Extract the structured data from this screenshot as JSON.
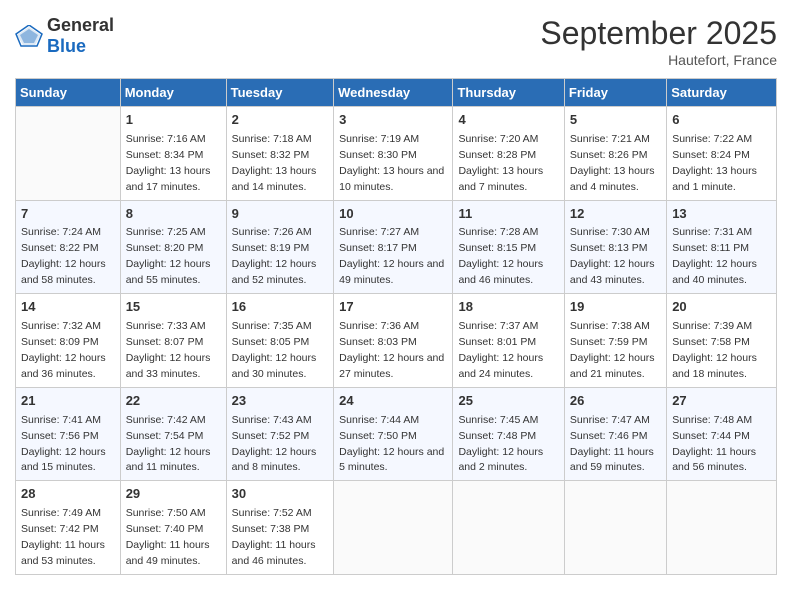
{
  "header": {
    "logo_general": "General",
    "logo_blue": "Blue",
    "month_title": "September 2025",
    "location": "Hautefort, France"
  },
  "days_of_week": [
    "Sunday",
    "Monday",
    "Tuesday",
    "Wednesday",
    "Thursday",
    "Friday",
    "Saturday"
  ],
  "weeks": [
    [
      {
        "day": "",
        "sunrise": "",
        "sunset": "",
        "daylight": ""
      },
      {
        "day": "1",
        "sunrise": "Sunrise: 7:16 AM",
        "sunset": "Sunset: 8:34 PM",
        "daylight": "Daylight: 13 hours and 17 minutes."
      },
      {
        "day": "2",
        "sunrise": "Sunrise: 7:18 AM",
        "sunset": "Sunset: 8:32 PM",
        "daylight": "Daylight: 13 hours and 14 minutes."
      },
      {
        "day": "3",
        "sunrise": "Sunrise: 7:19 AM",
        "sunset": "Sunset: 8:30 PM",
        "daylight": "Daylight: 13 hours and 10 minutes."
      },
      {
        "day": "4",
        "sunrise": "Sunrise: 7:20 AM",
        "sunset": "Sunset: 8:28 PM",
        "daylight": "Daylight: 13 hours and 7 minutes."
      },
      {
        "day": "5",
        "sunrise": "Sunrise: 7:21 AM",
        "sunset": "Sunset: 8:26 PM",
        "daylight": "Daylight: 13 hours and 4 minutes."
      },
      {
        "day": "6",
        "sunrise": "Sunrise: 7:22 AM",
        "sunset": "Sunset: 8:24 PM",
        "daylight": "Daylight: 13 hours and 1 minute."
      }
    ],
    [
      {
        "day": "7",
        "sunrise": "Sunrise: 7:24 AM",
        "sunset": "Sunset: 8:22 PM",
        "daylight": "Daylight: 12 hours and 58 minutes."
      },
      {
        "day": "8",
        "sunrise": "Sunrise: 7:25 AM",
        "sunset": "Sunset: 8:20 PM",
        "daylight": "Daylight: 12 hours and 55 minutes."
      },
      {
        "day": "9",
        "sunrise": "Sunrise: 7:26 AM",
        "sunset": "Sunset: 8:19 PM",
        "daylight": "Daylight: 12 hours and 52 minutes."
      },
      {
        "day": "10",
        "sunrise": "Sunrise: 7:27 AM",
        "sunset": "Sunset: 8:17 PM",
        "daylight": "Daylight: 12 hours and 49 minutes."
      },
      {
        "day": "11",
        "sunrise": "Sunrise: 7:28 AM",
        "sunset": "Sunset: 8:15 PM",
        "daylight": "Daylight: 12 hours and 46 minutes."
      },
      {
        "day": "12",
        "sunrise": "Sunrise: 7:30 AM",
        "sunset": "Sunset: 8:13 PM",
        "daylight": "Daylight: 12 hours and 43 minutes."
      },
      {
        "day": "13",
        "sunrise": "Sunrise: 7:31 AM",
        "sunset": "Sunset: 8:11 PM",
        "daylight": "Daylight: 12 hours and 40 minutes."
      }
    ],
    [
      {
        "day": "14",
        "sunrise": "Sunrise: 7:32 AM",
        "sunset": "Sunset: 8:09 PM",
        "daylight": "Daylight: 12 hours and 36 minutes."
      },
      {
        "day": "15",
        "sunrise": "Sunrise: 7:33 AM",
        "sunset": "Sunset: 8:07 PM",
        "daylight": "Daylight: 12 hours and 33 minutes."
      },
      {
        "day": "16",
        "sunrise": "Sunrise: 7:35 AM",
        "sunset": "Sunset: 8:05 PM",
        "daylight": "Daylight: 12 hours and 30 minutes."
      },
      {
        "day": "17",
        "sunrise": "Sunrise: 7:36 AM",
        "sunset": "Sunset: 8:03 PM",
        "daylight": "Daylight: 12 hours and 27 minutes."
      },
      {
        "day": "18",
        "sunrise": "Sunrise: 7:37 AM",
        "sunset": "Sunset: 8:01 PM",
        "daylight": "Daylight: 12 hours and 24 minutes."
      },
      {
        "day": "19",
        "sunrise": "Sunrise: 7:38 AM",
        "sunset": "Sunset: 7:59 PM",
        "daylight": "Daylight: 12 hours and 21 minutes."
      },
      {
        "day": "20",
        "sunrise": "Sunrise: 7:39 AM",
        "sunset": "Sunset: 7:58 PM",
        "daylight": "Daylight: 12 hours and 18 minutes."
      }
    ],
    [
      {
        "day": "21",
        "sunrise": "Sunrise: 7:41 AM",
        "sunset": "Sunset: 7:56 PM",
        "daylight": "Daylight: 12 hours and 15 minutes."
      },
      {
        "day": "22",
        "sunrise": "Sunrise: 7:42 AM",
        "sunset": "Sunset: 7:54 PM",
        "daylight": "Daylight: 12 hours and 11 minutes."
      },
      {
        "day": "23",
        "sunrise": "Sunrise: 7:43 AM",
        "sunset": "Sunset: 7:52 PM",
        "daylight": "Daylight: 12 hours and 8 minutes."
      },
      {
        "day": "24",
        "sunrise": "Sunrise: 7:44 AM",
        "sunset": "Sunset: 7:50 PM",
        "daylight": "Daylight: 12 hours and 5 minutes."
      },
      {
        "day": "25",
        "sunrise": "Sunrise: 7:45 AM",
        "sunset": "Sunset: 7:48 PM",
        "daylight": "Daylight: 12 hours and 2 minutes."
      },
      {
        "day": "26",
        "sunrise": "Sunrise: 7:47 AM",
        "sunset": "Sunset: 7:46 PM",
        "daylight": "Daylight: 11 hours and 59 minutes."
      },
      {
        "day": "27",
        "sunrise": "Sunrise: 7:48 AM",
        "sunset": "Sunset: 7:44 PM",
        "daylight": "Daylight: 11 hours and 56 minutes."
      }
    ],
    [
      {
        "day": "28",
        "sunrise": "Sunrise: 7:49 AM",
        "sunset": "Sunset: 7:42 PM",
        "daylight": "Daylight: 11 hours and 53 minutes."
      },
      {
        "day": "29",
        "sunrise": "Sunrise: 7:50 AM",
        "sunset": "Sunset: 7:40 PM",
        "daylight": "Daylight: 11 hours and 49 minutes."
      },
      {
        "day": "30",
        "sunrise": "Sunrise: 7:52 AM",
        "sunset": "Sunset: 7:38 PM",
        "daylight": "Daylight: 11 hours and 46 minutes."
      },
      {
        "day": "",
        "sunrise": "",
        "sunset": "",
        "daylight": ""
      },
      {
        "day": "",
        "sunrise": "",
        "sunset": "",
        "daylight": ""
      },
      {
        "day": "",
        "sunrise": "",
        "sunset": "",
        "daylight": ""
      },
      {
        "day": "",
        "sunrise": "",
        "sunset": "",
        "daylight": ""
      }
    ]
  ]
}
